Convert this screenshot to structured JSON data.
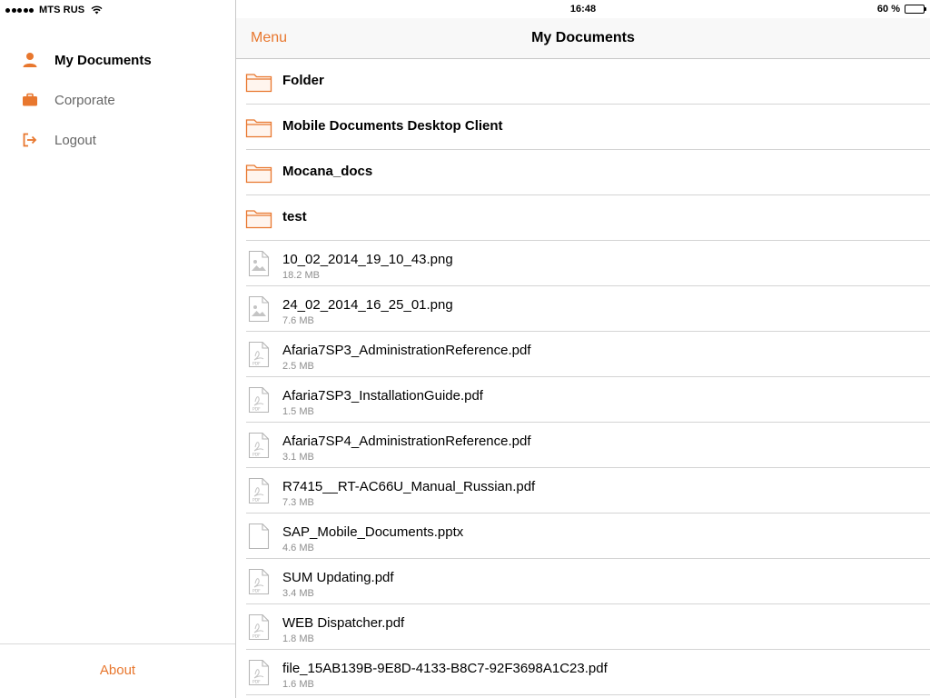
{
  "status": {
    "carrier": "MTS RUS",
    "time": "16:48",
    "battery": "60 %",
    "battery_level": 0.6
  },
  "sidebar": {
    "items": [
      {
        "label": "My Documents",
        "icon": "person-icon",
        "active": true
      },
      {
        "label": "Corporate",
        "icon": "briefcase-icon",
        "active": false
      },
      {
        "label": "Logout",
        "icon": "logout-icon",
        "active": false
      }
    ],
    "about": "About"
  },
  "navbar": {
    "menu_label": "Menu",
    "title": "My Documents"
  },
  "folders": [
    {
      "name": "Folder"
    },
    {
      "name": "Mobile Documents Desktop Client"
    },
    {
      "name": "Mocana_docs"
    },
    {
      "name": "test"
    }
  ],
  "files": [
    {
      "name": "10_02_2014_19_10_43.png",
      "size": "18.2 MB",
      "icon": "image-file-icon"
    },
    {
      "name": "24_02_2014_16_25_01.png",
      "size": "7.6 MB",
      "icon": "image-file-icon"
    },
    {
      "name": "Afaria7SP3_AdministrationReference.pdf",
      "size": "2.5 MB",
      "icon": "pdf-file-icon"
    },
    {
      "name": "Afaria7SP3_InstallationGuide.pdf",
      "size": "1.5 MB",
      "icon": "pdf-file-icon"
    },
    {
      "name": "Afaria7SP4_AdministrationReference.pdf",
      "size": "3.1 MB",
      "icon": "pdf-file-icon"
    },
    {
      "name": "R7415__RT-AC66U_Manual_Russian.pdf",
      "size": "7.3 MB",
      "icon": "pdf-file-icon"
    },
    {
      "name": "SAP_Mobile_Documents.pptx",
      "size": "4.6 MB",
      "icon": "blank-file-icon"
    },
    {
      "name": "SUM Updating.pdf",
      "size": "3.4 MB",
      "icon": "pdf-file-icon"
    },
    {
      "name": "WEB Dispatcher.pdf",
      "size": "1.8 MB",
      "icon": "pdf-file-icon"
    },
    {
      "name": "file_15AB139B-9E8D-4133-B8C7-92F3698A1C23.pdf",
      "size": "1.6 MB",
      "icon": "pdf-file-icon"
    }
  ],
  "colors": {
    "accent": "#e8772e",
    "folder_stroke": "#e8772e"
  }
}
